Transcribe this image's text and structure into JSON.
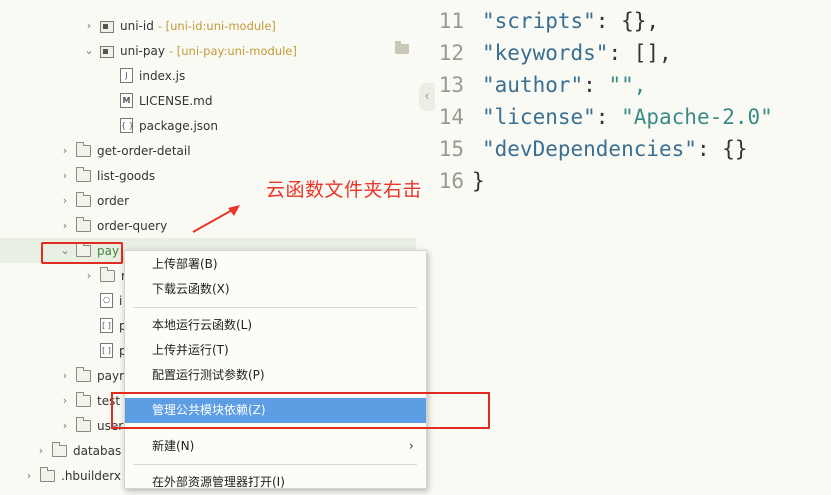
{
  "tree": {
    "items": [
      {
        "label": "uni-id",
        "sub": "- [uni-id:uni-module]"
      },
      {
        "label": "uni-pay",
        "sub": "- [uni-pay:uni-module]"
      },
      {
        "label": "index.js"
      },
      {
        "label": "LICENSE.md"
      },
      {
        "label": "package.json"
      },
      {
        "label": "get-order-detail"
      },
      {
        "label": "list-goods"
      },
      {
        "label": "order"
      },
      {
        "label": "order-query"
      },
      {
        "label": "pay"
      },
      {
        "label": "r"
      },
      {
        "label": "i"
      },
      {
        "label": "p"
      },
      {
        "label": "p"
      },
      {
        "label": "payr"
      },
      {
        "label": "test"
      },
      {
        "label": "user"
      },
      {
        "label": "databas"
      },
      {
        "label": ".hbuilderx"
      }
    ]
  },
  "editor": {
    "lines": [
      {
        "num": "11",
        "key": "\"scripts\"",
        "sep": ": ",
        "val": "{},",
        "valtype": "p"
      },
      {
        "num": "12",
        "key": "\"keywords\"",
        "sep": ": ",
        "val": "[],",
        "valtype": "p"
      },
      {
        "num": "13",
        "key": "\"author\"",
        "sep": ": ",
        "val": "\"\",",
        "valtype": "s"
      },
      {
        "num": "14",
        "key": "\"license\"",
        "sep": ": ",
        "val": "\"Apache-2.0\"",
        "valtype": "s"
      },
      {
        "num": "15",
        "key": "\"devDependencies\"",
        "sep": ": ",
        "val": "{}",
        "valtype": "p"
      },
      {
        "num": "16",
        "key": "}",
        "sep": "",
        "val": "",
        "valtype": "p"
      }
    ]
  },
  "annotation": {
    "text": "云函数文件夹右击",
    "color": "#e8362b"
  },
  "menu": {
    "items": [
      {
        "label": "上传部署(B)"
      },
      {
        "label": "下载云函数(X)"
      },
      {
        "label": "本地运行云函数(L)"
      },
      {
        "label": "上传并运行(T)"
      },
      {
        "label": "配置运行测试参数(P)"
      },
      {
        "label": "管理公共模块依赖(Z)"
      },
      {
        "label": "新建(N)"
      },
      {
        "label": "在外部资源管理器打开(I)"
      }
    ],
    "selected_color": "#5d9de3"
  }
}
